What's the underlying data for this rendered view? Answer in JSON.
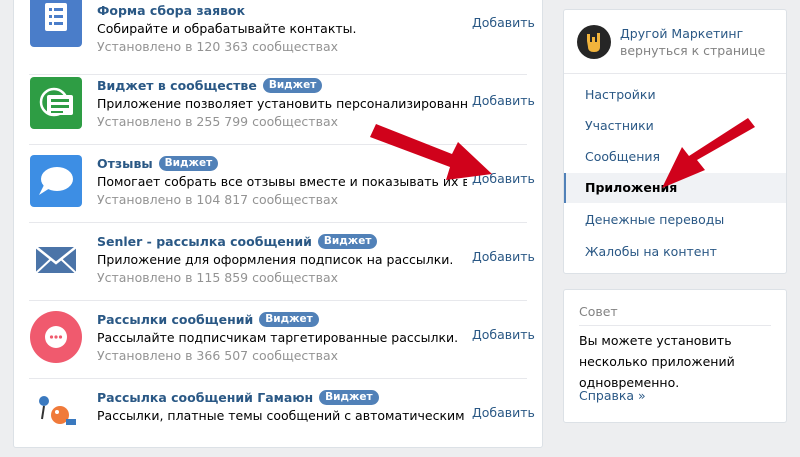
{
  "apps": [
    {
      "title": "Форма сбора заявок",
      "badge": "",
      "desc": "Собирайте и обрабатывайте контакты.",
      "installed": "Установлено в 120 363 сообществах",
      "add": "Добавить",
      "icon": "form-icon",
      "color": "#4a7dc9"
    },
    {
      "title": "Виджет в сообществе",
      "badge": "Виджет",
      "desc": "Приложение позволяет установить персонализированн...",
      "installed": "Установлено в 255 799 сообществах",
      "add": "Добавить",
      "icon": "widget-icon",
      "color": "#2e9d44"
    },
    {
      "title": "Отзывы",
      "badge": "Виджет",
      "desc": "Помогает собрать все отзывы вместе и показывать их в...",
      "installed": "Установлено в 104 817 сообществах",
      "add": "Добавить",
      "icon": "speech-bubble-icon",
      "color": "#3d8ee4"
    },
    {
      "title": "Senler - рассылка сообщений",
      "badge": "Виджет",
      "desc": "Приложение для оформления подписок на рассылки.",
      "installed": "Установлено в 115 859 сообществах",
      "add": "Добавить",
      "icon": "envelope-icon",
      "color": "#4b74a8"
    },
    {
      "title": "Рассылки сообщений",
      "badge": "Виджет",
      "desc": "Рассылайте подписчикам таргетированные рассылки.",
      "installed": "Установлено в 366 507 сообществах",
      "add": "Добавить",
      "icon": "chat-dots-icon",
      "color": "#f05a6e"
    },
    {
      "title": "Рассылка сообщений Гамаюн",
      "badge": "Виджет",
      "desc": "Рассылки, платные темы сообщений с автоматическим пр...",
      "installed": "",
      "add": "Добавить",
      "icon": "bird-icon",
      "color": "#3a79bf"
    }
  ],
  "community": {
    "name": "Другой Маркетинг",
    "back": "вернуться к странице"
  },
  "menu": [
    "Настройки",
    "Участники",
    "Сообщения",
    "Приложения",
    "Денежные переводы",
    "Жалобы на контент"
  ],
  "active_menu": "Приложения",
  "tip": {
    "title": "Совет",
    "text": "Вы можете установить несколько приложений одновременно.",
    "link": "Справка »"
  },
  "colors": {
    "accent": "#5181b8",
    "link": "#2a5885",
    "arrow": "#d0021b",
    "background": "#edeef0"
  }
}
